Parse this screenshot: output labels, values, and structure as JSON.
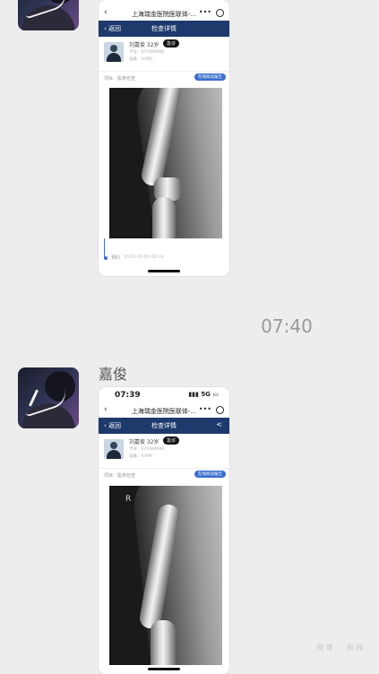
{
  "chat": {
    "timestamp": "07:40",
    "sender_name": "嘉俊",
    "watermark": "微博 · 新闻"
  },
  "shot1": {
    "app_title": "上海瑞金医院医联体-...",
    "nav_dots": "•••",
    "back": "返回",
    "page_title": "检查详情",
    "patient_name": "刘嘉俊 32岁",
    "tag": "急诊",
    "line1": "卡号：671984900",
    "line2": "设备：X-RAY",
    "exam_label": "项目：肱骨检查",
    "exam_button": "在线阅读报告",
    "timeline_label": "预约",
    "timeline_date": "2020-10-09 00:14"
  },
  "shot2": {
    "status_time": "07:39",
    "status_signal": "5G",
    "app_title": "上海瑞金医院医联体-...",
    "nav_dots": "•••",
    "back": "返回",
    "page_title": "检查详情",
    "share_icon": "share-icon",
    "patient_name": "刘嘉俊 32岁",
    "tag": "急诊",
    "line1": "卡号：671984900",
    "line2": "设备：X-RAY",
    "exam_label": "项目：肱骨检查",
    "exam_button": "在线阅读报告",
    "xray_marker": "R"
  }
}
